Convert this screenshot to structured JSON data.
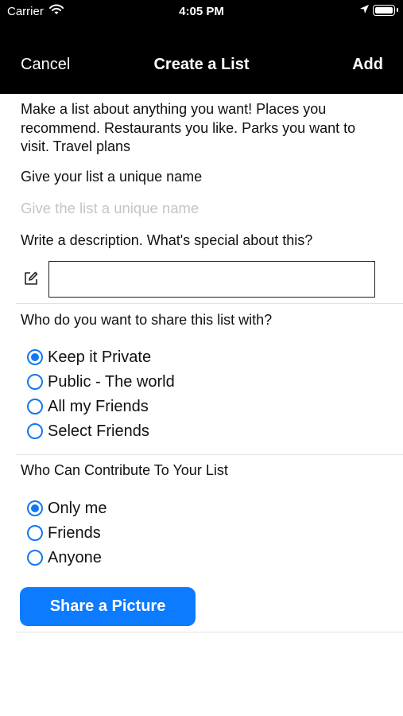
{
  "status_bar": {
    "carrier": "Carrier",
    "time": "4:05 PM"
  },
  "nav": {
    "cancel": "Cancel",
    "title": "Create a List",
    "add": "Add"
  },
  "intro": "Make a list about anything you want! Places you recommend. Restaurants you like. Parks you want to visit. Travel plans",
  "name_section": {
    "label": "Give your list a unique name",
    "placeholder": "Give the list a unique name",
    "value": ""
  },
  "description_section": {
    "label": "Write a description. What's special about this?",
    "value": ""
  },
  "share_section": {
    "label": "Who do you want to share this list with?",
    "options": [
      "Keep it Private",
      "Public - The world",
      "All my Friends",
      "Select Friends"
    ],
    "selected": "Keep it Private"
  },
  "contribute_section": {
    "label": "Who Can Contribute To Your List",
    "options": [
      "Only me",
      "Friends",
      "Anyone"
    ],
    "selected": "Only me"
  },
  "share_picture_button": "Share a Picture",
  "colors": {
    "accent": "#1378f0",
    "button": "#0c7bff",
    "nav_background": "#000000"
  },
  "icons": {
    "wifi": "wifi-icon",
    "location": "location-arrow-icon",
    "battery": "battery-icon",
    "edit": "edit-icon"
  }
}
